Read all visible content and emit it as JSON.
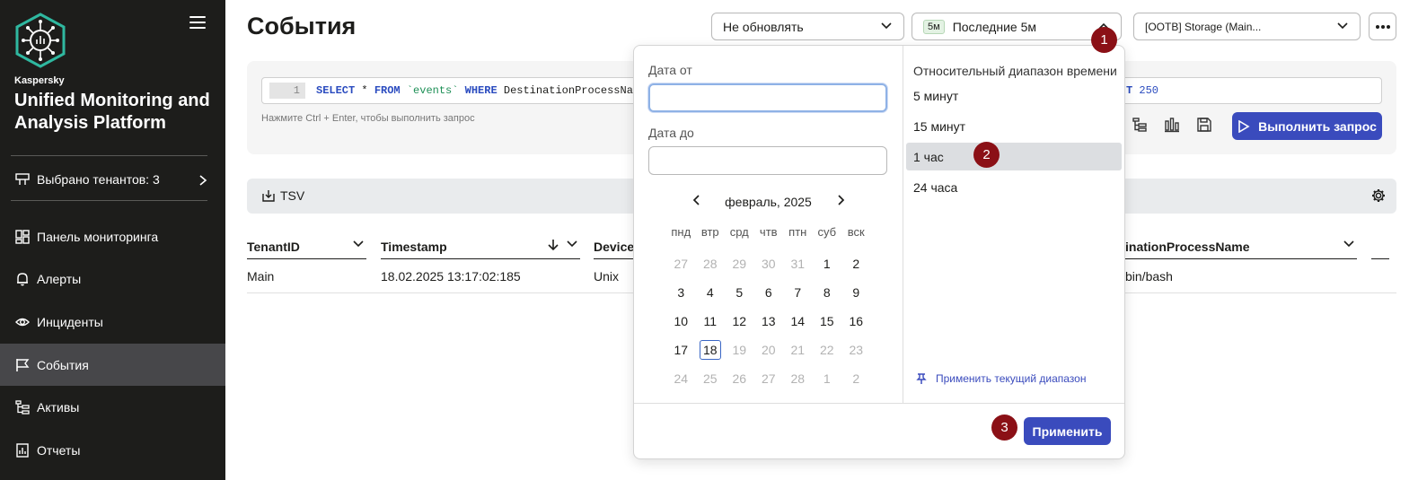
{
  "sidebar": {
    "brand_small": "Kaspersky",
    "brand_big": "Unified Monitoring and Analysis Platform",
    "tenants_label": "Выбрано тенантов: 3",
    "items": [
      {
        "label": "Панель мониторинга",
        "icon": "dashboard-icon"
      },
      {
        "label": "Алерты",
        "icon": "bell-icon"
      },
      {
        "label": "Инциденты",
        "icon": "eye-icon"
      },
      {
        "label": "События",
        "icon": "flag-icon",
        "active": true
      },
      {
        "label": "Активы",
        "icon": "tree-list-icon"
      },
      {
        "label": "Отчеты",
        "icon": "report-icon"
      }
    ]
  },
  "header": {
    "title": "События",
    "refresh_select": "Не обновлять",
    "period_badge": "5м",
    "period_select": "Последние 5м",
    "storage_select": "[OOTB] Storage (Main..."
  },
  "query": {
    "line_number": "1",
    "code": {
      "select": "SELECT",
      "star": " * ",
      "from": "FROM",
      "table": " `events` ",
      "where": "WHERE",
      "field": " DestinationProcessName",
      "limit_tail": "T",
      "limit_value": "250"
    },
    "hint": "Нажмите Ctrl + Enter, чтобы выполнить запрос",
    "run_label": "Выполнить запрос"
  },
  "results": {
    "export_label": "TSV",
    "columns": [
      "TenantID",
      "Timestamp",
      "Device",
      "inationProcessName"
    ],
    "rows": [
      {
        "tenant": "Main",
        "timestamp": "18.02.2025 13:17:02:185",
        "device": "Unix",
        "process": "bin/bash"
      }
    ]
  },
  "date_picker": {
    "from_label": "Дата от",
    "from_value": "",
    "to_label": "Дата до",
    "to_value": "",
    "month_label": "февраль, 2025",
    "weekdays": [
      "пнд",
      "втр",
      "срд",
      "чтв",
      "птн",
      "суб",
      "вск"
    ],
    "weeks": [
      [
        "27",
        "28",
        "29",
        "30",
        "31",
        "1",
        "2"
      ],
      [
        "3",
        "4",
        "5",
        "6",
        "7",
        "8",
        "9"
      ],
      [
        "10",
        "11",
        "12",
        "13",
        "14",
        "15",
        "16"
      ],
      [
        "17",
        "18",
        "19",
        "20",
        "21",
        "22",
        "23"
      ],
      [
        "24",
        "25",
        "26",
        "27",
        "28",
        "1",
        "2"
      ]
    ],
    "relative_title": "Относительный диапазон времени",
    "relative_options": [
      "5 минут",
      "15 минут",
      "1 час",
      "24 часа"
    ],
    "apply_current_label": "Применить текущий диапазон",
    "apply_label": "Применить"
  },
  "markers": [
    "1",
    "2",
    "3"
  ],
  "colors": {
    "sidebar_bg": "#1d1d1b",
    "accent": "#3a4bbd",
    "marker": "#8b1016",
    "active_nav": "#47474a"
  }
}
